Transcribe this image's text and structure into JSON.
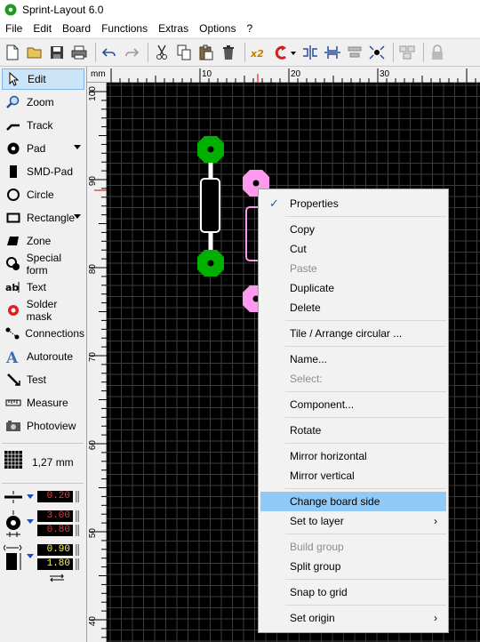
{
  "window": {
    "title": "Sprint-Layout 6.0"
  },
  "menubar": [
    "File",
    "Edit",
    "Board",
    "Functions",
    "Extras",
    "Options",
    "?"
  ],
  "toolbar": {
    "icons": [
      "new-file-icon",
      "open-folder-icon",
      "save-icon",
      "print-icon",
      "undo-icon",
      "redo-icon",
      "cut-icon",
      "copy-icon",
      "paste-icon",
      "delete-icon",
      "zoom-x2-icon",
      "rotate-icon",
      "mirror-horizontal-icon",
      "mirror-vertical-icon",
      "align-icon",
      "snap-icon",
      "group-icon",
      "lock-icon"
    ],
    "zoom_label": "x2"
  },
  "tools": [
    {
      "label": "Edit",
      "icon": "cursor-arrow-icon",
      "active": true
    },
    {
      "label": "Zoom",
      "icon": "magnifier-icon"
    },
    {
      "label": "Track",
      "icon": "track-icon"
    },
    {
      "label": "Pad",
      "icon": "pad-icon",
      "dropdown": true
    },
    {
      "label": "SMD-Pad",
      "icon": "smd-pad-icon"
    },
    {
      "label": "Circle",
      "icon": "circle-icon"
    },
    {
      "label": "Rectangle",
      "icon": "rectangle-icon",
      "dropdown": true
    },
    {
      "label": "Zone",
      "icon": "zone-icon"
    },
    {
      "label": "Special form",
      "icon": "special-form-icon"
    },
    {
      "label": "Text",
      "icon": "text-icon"
    },
    {
      "label": "Solder mask",
      "icon": "solder-mask-icon"
    },
    {
      "label": "Connections",
      "icon": "connections-icon"
    },
    {
      "label": "Autoroute",
      "icon": "autoroute-icon"
    },
    {
      "label": "Test",
      "icon": "test-icon"
    },
    {
      "label": "Measure",
      "icon": "measure-icon"
    },
    {
      "label": "Photoview",
      "icon": "photoview-icon"
    }
  ],
  "grid": {
    "value": "1,27 mm"
  },
  "track_width": "0.20",
  "pad_outer": "3.00",
  "pad_inner": "0.80",
  "smd_width": "0.90",
  "smd_height": "1.80",
  "ruler": {
    "unit": "mm",
    "h_labels": [
      "10",
      "20",
      "30"
    ],
    "v_labels": [
      "100",
      "90",
      "80",
      "70",
      "60",
      "50",
      "40"
    ]
  },
  "context_menu": {
    "items": [
      {
        "label": "Properties",
        "checked": true
      },
      {
        "sep": true
      },
      {
        "label": "Copy"
      },
      {
        "label": "Cut"
      },
      {
        "label": "Paste",
        "disabled": true
      },
      {
        "label": "Duplicate"
      },
      {
        "label": "Delete"
      },
      {
        "sep": true
      },
      {
        "label": "Tile / Arrange circular ..."
      },
      {
        "sep": true
      },
      {
        "label": "Name..."
      },
      {
        "label": "Select:",
        "disabled": true
      },
      {
        "sep": true
      },
      {
        "label": "Component..."
      },
      {
        "sep": true
      },
      {
        "label": "Rotate"
      },
      {
        "sep": true
      },
      {
        "label": "Mirror horizontal"
      },
      {
        "label": "Mirror vertical"
      },
      {
        "sep": true
      },
      {
        "label": "Change board side",
        "highlighted": true
      },
      {
        "label": "Set to layer",
        "submenu": true
      },
      {
        "sep": true
      },
      {
        "label": "Build group",
        "disabled": true
      },
      {
        "label": "Split group"
      },
      {
        "sep": true
      },
      {
        "label": "Snap to grid"
      },
      {
        "sep": true
      },
      {
        "label": "Set origin",
        "submenu": true
      }
    ]
  },
  "colors": {
    "pad_green": "#00b000",
    "pad_pink": "#ff99ee",
    "canvas": "#000000",
    "grid": "#3c3c3c",
    "menu_highlight": "#91c9f7"
  }
}
